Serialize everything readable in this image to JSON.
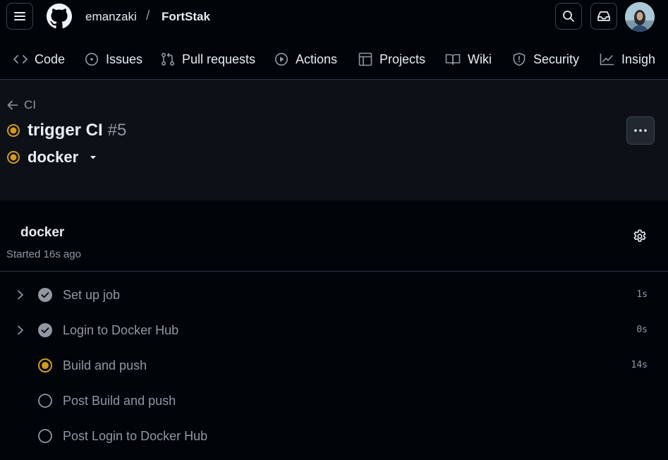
{
  "app": {
    "owner": "emanzaki",
    "separator": "/",
    "repo": "FortStak"
  },
  "nav": [
    {
      "label": "Code",
      "icon": "code-icon"
    },
    {
      "label": "Issues",
      "icon": "issue-opened-icon"
    },
    {
      "label": "Pull requests",
      "icon": "git-pull-request-icon"
    },
    {
      "label": "Actions",
      "icon": "play-icon"
    },
    {
      "label": "Projects",
      "icon": "table-icon"
    },
    {
      "label": "Wiki",
      "icon": "book-icon"
    },
    {
      "label": "Security",
      "icon": "shield-icon"
    },
    {
      "label": "Insigh",
      "icon": "graph-icon"
    }
  ],
  "run": {
    "back_label": "CI",
    "title": "trigger CI",
    "number": "#5",
    "job_selector": "docker",
    "status": "in_progress"
  },
  "job": {
    "name": "docker",
    "started": "Started 16s ago"
  },
  "steps": [
    {
      "label": "Set up job",
      "duration": "1s",
      "status": "success",
      "expandable": true
    },
    {
      "label": "Login to Docker Hub",
      "duration": "0s",
      "status": "success",
      "expandable": true
    },
    {
      "label": "Build and push",
      "duration": "14s",
      "status": "in_progress",
      "expandable": false
    },
    {
      "label": "Post Build and push",
      "duration": "",
      "status": "pending",
      "expandable": false
    },
    {
      "label": "Post Login to Docker Hub",
      "duration": "",
      "status": "pending",
      "expandable": false
    }
  ],
  "colors": {
    "background": "#010409",
    "header_bg": "#0d1117",
    "in_progress": "#d29922",
    "success": "#9198a1",
    "text": "#e6edf3",
    "muted": "#9198a1"
  }
}
